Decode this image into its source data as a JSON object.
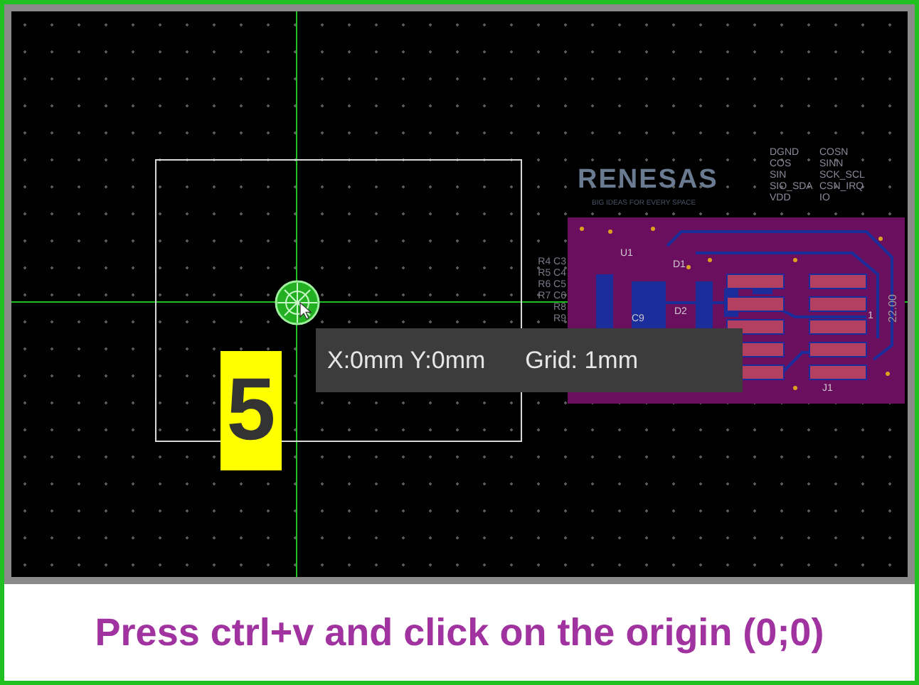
{
  "canvas": {
    "board": {
      "logo": "RENESAS",
      "tagline": "BIG IDEAS FOR EVERY SPACE",
      "pin_labels": [
        "DGND",
        "COSN",
        "COS",
        "SINN",
        "SIN",
        "SCK_SCL",
        "SIO_SDA",
        "CSN_IRQ",
        "VDD",
        "IO"
      ],
      "part_labels": [
        "R4 C3",
        "R5 C4",
        "R6 C5",
        "R7 C6",
        "R8",
        "R9"
      ],
      "ref_labels": [
        {
          "text": "U1"
        },
        {
          "text": "C9"
        },
        {
          "text": "D1"
        },
        {
          "text": "D2"
        },
        {
          "text": "J1"
        },
        {
          "text": "1"
        }
      ],
      "dimension": "22.00"
    },
    "tooltip": {
      "coordinates": "X:0mm Y:0mm",
      "grid": "Grid: 1mm"
    },
    "step_number": "5"
  },
  "caption": "Press ctrl+v and click on the origin (0;0)"
}
